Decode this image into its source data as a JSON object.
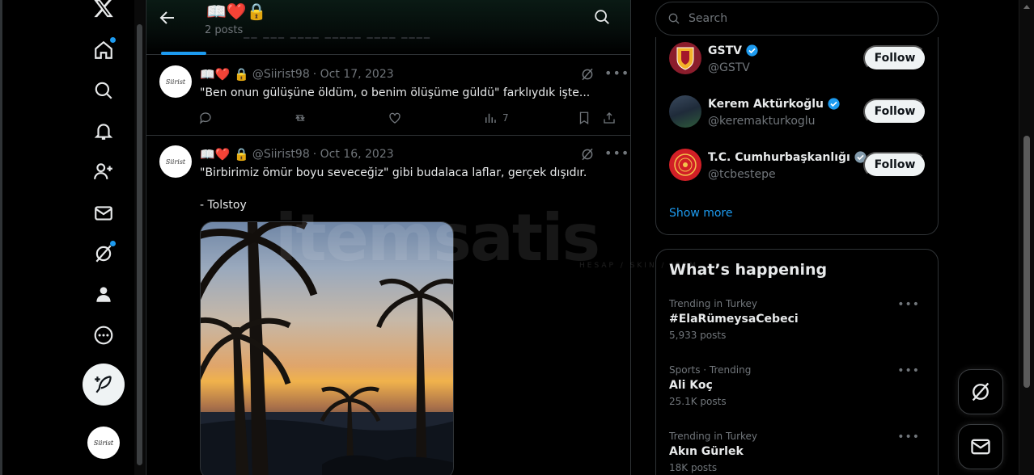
{
  "header": {
    "title_emoji": "📖❤️🔒",
    "posts_count": "2 posts"
  },
  "tweets": [
    {
      "name_emoji": "📖❤️ 🔒",
      "handle": "@Siirist98",
      "date": "· Oct 17, 2023",
      "text": "\"Ben onun gülüşüne öldüm, o benim ölüşüme güldü\" farklıydık işte...",
      "views": "7"
    },
    {
      "name_emoji": "📖❤️ 🔒",
      "handle": "@Siirist98",
      "date": "· Oct 16, 2023",
      "text": "\"Birbirimiz ömür boyu seveceğiz\" gibi budalaca laflar, gerçek dışıdır.\n\n- Tolstoy"
    }
  ],
  "avatar_text": "Siirist",
  "search": {
    "placeholder": "Search"
  },
  "who_to_follow": [
    {
      "name": "GSTV",
      "handle": "@GSTV",
      "verified_color": "#1d9bf0",
      "button": "Follow"
    },
    {
      "name": "Kerem Aktürkoğlu",
      "handle": "@keremakturkoglu",
      "verified_color": "#1d9bf0",
      "button": "Follow"
    },
    {
      "name": "T.C. Cumhurbaşkanlığı",
      "handle": "@tcbestepe",
      "verified_color": "#829aab",
      "button": "Follow"
    }
  ],
  "show_more": "Show more",
  "whats_happening": {
    "title": "What’s happening",
    "trends": [
      {
        "context": "Trending in Turkey",
        "topic": "#ElaRümeysaCebeci",
        "count": "5,933 posts"
      },
      {
        "context": "Sports · Trending",
        "topic": "Ali Koç",
        "count": "25.1K posts"
      },
      {
        "context": "Trending in Turkey",
        "topic": "Akın Gürlek",
        "count": "18K posts"
      }
    ]
  },
  "watermark": {
    "main": "itemsatis",
    "sub": "HESAP / SKIN / ITEM"
  },
  "colors": {
    "accent": "#1d9bf0",
    "muted": "#71767b",
    "border": "#2f3336"
  }
}
